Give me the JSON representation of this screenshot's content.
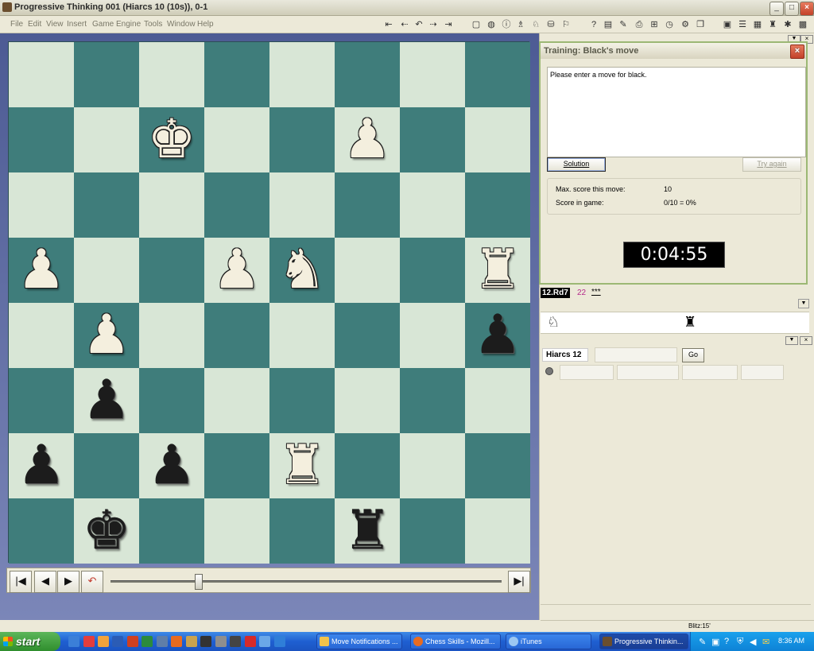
{
  "window": {
    "title": "Progressive Thinking 001  (Hiarcs 10 (10s)), 0-1",
    "controls": [
      "_",
      "□",
      "×"
    ]
  },
  "menu": [
    "File",
    "Edit",
    "View",
    "Insert",
    "Game",
    "Engine",
    "Tools",
    "Window",
    "Help"
  ],
  "board": {
    "light": "#d8e6d6",
    "dark": "#3f7d7b",
    "position": [
      [
        "",
        "",
        "",
        "",
        "",
        "",
        "",
        ""
      ],
      [
        "",
        "",
        "K",
        "",
        "",
        "P",
        "",
        ""
      ],
      [
        "",
        "",
        "",
        "",
        "",
        "",
        "",
        ""
      ],
      [
        "P",
        "",
        "",
        "P",
        "N",
        "",
        "",
        "R"
      ],
      [
        "",
        "P",
        "",
        "",
        "",
        "",
        "",
        "p"
      ],
      [
        "",
        "p",
        "",
        "",
        "",
        "",
        "",
        ""
      ],
      [
        "p",
        "",
        "p",
        "",
        "R",
        "",
        "",
        ""
      ],
      [
        "",
        "k",
        "",
        "",
        "",
        "r",
        "",
        ""
      ]
    ]
  },
  "nav": {
    "first": "|◀",
    "prev": "◀",
    "next": "▶",
    "undo": "↶",
    "last": "▶|"
  },
  "training": {
    "title": "Training: Black's move",
    "message": "Please enter a move for black.",
    "solution_label": "Solution",
    "try_again_label": "Try again",
    "max_score_label": "Max. score this move:",
    "max_score_value": "10",
    "score_game_label": "Score in game:",
    "score_game_value": "0/10 =  0%",
    "clock": "0:04:55"
  },
  "notation": {
    "move": "12.Rd7",
    "move_num": "22",
    "annotation": "***"
  },
  "engine": {
    "name": "Hiarcs 12",
    "go_label": "Go"
  },
  "statusbar": {
    "text": "Blitz:15'"
  },
  "taskbar": {
    "start_label": "start",
    "items": [
      {
        "label": "Move Notifications ..."
      },
      {
        "label": "Chess Skills - Mozill..."
      },
      {
        "label": "iTunes"
      },
      {
        "label": "Progressive Thinkin..."
      }
    ],
    "clock": "8:36 AM"
  }
}
